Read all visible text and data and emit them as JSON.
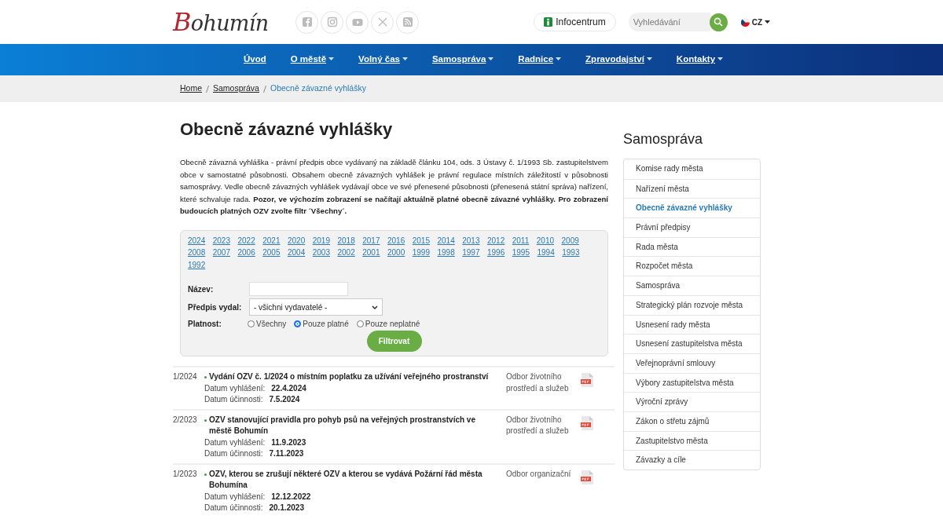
{
  "header": {
    "logo": "Bohumín",
    "social": [
      {
        "kind": "facebook"
      },
      {
        "kind": "instagram"
      },
      {
        "kind": "youtube"
      },
      {
        "kind": "x"
      },
      {
        "kind": "rss"
      }
    ],
    "info_button": "Infocentrum",
    "search": {
      "placeholder": "Vyhledávání"
    },
    "language": "CZ"
  },
  "nav": [
    {
      "label": "Úvod",
      "dropdown": false
    },
    {
      "label": "O městě",
      "dropdown": true
    },
    {
      "label": "Volný čas",
      "dropdown": true
    },
    {
      "label": "Samospráva",
      "dropdown": true
    },
    {
      "label": "Radnice",
      "dropdown": true
    },
    {
      "label": "Zpravodajství",
      "dropdown": true
    },
    {
      "label": "Kontakty",
      "dropdown": true
    }
  ],
  "breadcrumb": [
    {
      "label": "Home",
      "current": false
    },
    {
      "label": "Samospráva",
      "current": false
    },
    {
      "label": "Obecně závazné vyhlášky",
      "current": true
    }
  ],
  "page_title": "Obecně závazné vyhlášky",
  "intro": "Obecně závazná vyhláška - právní předpis obce vydávaný na základě článku 104, ods. 3 Ústavy č. 1/1993 Sb. zastupitelstvem obce v samostatné působnosti. Obsahem obecně závazných vyhlášek je právní regulace místních záležitostí v působnosti samosprávy. Vedle obecně závazných vyhlášek vydávají obce ve své přenesené působnosti (přenesená státní správa) nařízení, které schvaluje rada. **Pozor, ve výchozím zobrazení se načítají aktuálně platné obecně závazné vyhlášky. Pro zobrazení budoucích platných OZV zvolte filtr ´Všechny´.**",
  "filter": {
    "years": [
      "2024",
      "2023",
      "2022",
      "2021",
      "2020",
      "2019",
      "2018",
      "2017",
      "2016",
      "2015",
      "2014",
      "2013",
      "2012",
      "2011",
      "2010",
      "2009",
      "2008",
      "2007",
      "2006",
      "2005",
      "2004",
      "2003",
      "2002",
      "2001",
      "2000",
      "1999",
      "1998",
      "1997",
      "1996",
      "1995",
      "1994",
      "1993",
      "1992"
    ],
    "name_label": "Název:",
    "issuer_label": "Předpis vydal:",
    "issuer_value": "- všichni vydavatelé -",
    "validity_label": "Platnost:",
    "validity_options": [
      {
        "label": "Všechny",
        "selected": false
      },
      {
        "label": "Pouze platné",
        "selected": true
      },
      {
        "label": "Pouze neplatné",
        "selected": false
      }
    ],
    "button": "Filtrovat"
  },
  "regulations": [
    {
      "number": "1/2024",
      "title": "Vydání OZV č. 1/2024 o místním poplatku za užívání veřejného prostranství",
      "issued_label": "Datum vyhlášení:",
      "issued": "22.4.2024",
      "effective_label": "Datum účinnosti:",
      "effective": "7.5.2024",
      "department": "Odbor životního prostředí a služeb"
    },
    {
      "number": "2/2023",
      "title": "OZV stanovující pravidla pro pohyb psů na veřejných prostranstvích ve městě Bohumín",
      "issued_label": "Datum vyhlášení:",
      "issued": "11.9.2023",
      "effective_label": "Datum účinnosti:",
      "effective": "7.11.2023",
      "department": "Odbor životního prostředí a služeb"
    },
    {
      "number": "1/2023",
      "title": "OZV, kterou se zrušují některé OZV a kterou se vydává Požární řád města Bohumína",
      "issued_label": "Datum vyhlášení:",
      "issued": "12.12.2022",
      "effective_label": "Datum účinnosti:",
      "effective": "20.1.2023",
      "department": "Odbor organizační"
    }
  ],
  "sidebar": {
    "title": "Samospráva",
    "items": [
      {
        "label": "Komise rady města",
        "selected": false
      },
      {
        "label": "Nařízení města",
        "selected": false
      },
      {
        "label": "Obecně závazné vyhlášky",
        "selected": true
      },
      {
        "label": "Právní předpisy",
        "selected": false
      },
      {
        "label": "Rada města",
        "selected": false
      },
      {
        "label": "Rozpočet města",
        "selected": false
      },
      {
        "label": "Samospráva",
        "selected": false
      },
      {
        "label": "Strategický plán rozvoje města",
        "selected": false
      },
      {
        "label": "Usnesení rady města",
        "selected": false
      },
      {
        "label": "Usnesení zastupitelstva města",
        "selected": false
      },
      {
        "label": "Veřejnoprávní smlouvy",
        "selected": false
      },
      {
        "label": "Výbory zastupitelstva města",
        "selected": false
      },
      {
        "label": "Výroční zprávy",
        "selected": false
      },
      {
        "label": "Zákon o střetu zájmů",
        "selected": false
      },
      {
        "label": "Zastupitelstvo města",
        "selected": false
      },
      {
        "label": "Závazky a cíle",
        "selected": false
      }
    ]
  }
}
